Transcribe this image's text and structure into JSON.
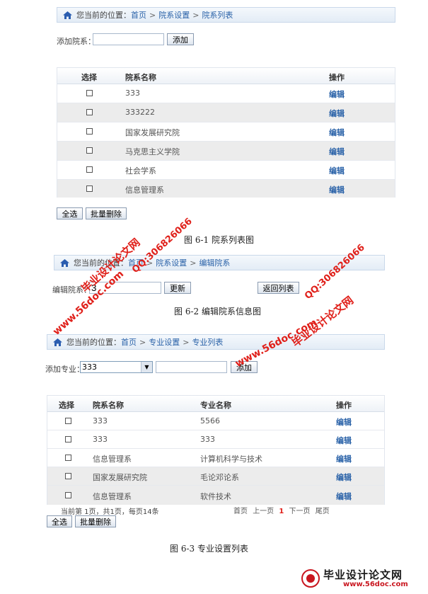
{
  "panel1": {
    "crumb": {
      "prefix": "您当前的位置：",
      "home": "首页",
      "sep": ">",
      "c1": "院系设置",
      "c2": "院系列表"
    },
    "add_label": "添加院系：",
    "add_button": "添加",
    "headers": {
      "select": "选择",
      "name": "院系名称",
      "op": "操作"
    },
    "rows": [
      {
        "name": "333",
        "edit": "编辑"
      },
      {
        "name": "333222",
        "edit": "编辑"
      },
      {
        "name": "国家发展研究院",
        "edit": "编辑"
      },
      {
        "name": "马克思主义学院",
        "edit": "编辑"
      },
      {
        "name": "社会学系",
        "edit": "编辑"
      },
      {
        "name": "信息管理系",
        "edit": "编辑"
      }
    ],
    "select_all": "全选",
    "batch_delete": "批量删除",
    "caption": "图 6-1  院系列表图"
  },
  "panel2": {
    "crumb": {
      "prefix": "您当前的位置：",
      "home": "首页",
      "sep": ">",
      "c1": "院系设置",
      "c2": "编辑院系"
    },
    "edit_label": "编辑院系：",
    "edit_value": "3",
    "update_button": "更新",
    "back_button": "返回列表",
    "caption": "图 6-2  编辑院系信息图"
  },
  "panel3": {
    "crumb": {
      "prefix": "您当前的位置：",
      "home": "首页",
      "sep": ">",
      "c1": "专业设置",
      "c2": "专业列表"
    },
    "add_label": "添加专业：",
    "select_value": "333",
    "add_button": "添加",
    "headers": {
      "select": "选择",
      "dept": "院系名称",
      "major": "专业名称",
      "op": "操作"
    },
    "rows": [
      {
        "dept": "333",
        "major": "5566",
        "edit": "编辑"
      },
      {
        "dept": "333",
        "major": "333",
        "edit": "编辑"
      },
      {
        "dept": "信息管理系",
        "major": "计算机科学与技术",
        "edit": "编辑"
      },
      {
        "dept": "国家发展研究院",
        "major": "毛论邓论系",
        "edit": "编辑"
      },
      {
        "dept": "信息管理系",
        "major": "软件技术",
        "edit": "编辑"
      }
    ],
    "pager_info": "当前第 1页，共1页，每页14条",
    "pager": {
      "first": "首页",
      "prev": "上一页",
      "current": "1",
      "next": "下一页",
      "last": "尾页"
    },
    "select_all": "全选",
    "batch_delete": "批量删除",
    "caption": "图 6-3  专业设置列表"
  },
  "watermarks": {
    "site": "www.56doc.com",
    "qq": "QQ:306826066",
    "brand": "毕业设计论文网"
  },
  "logo": {
    "text": "毕业设计论文网",
    "url": "www.56doc.com"
  },
  "colors": {
    "link": "#2a62a8",
    "watermark": "#e0201a"
  }
}
